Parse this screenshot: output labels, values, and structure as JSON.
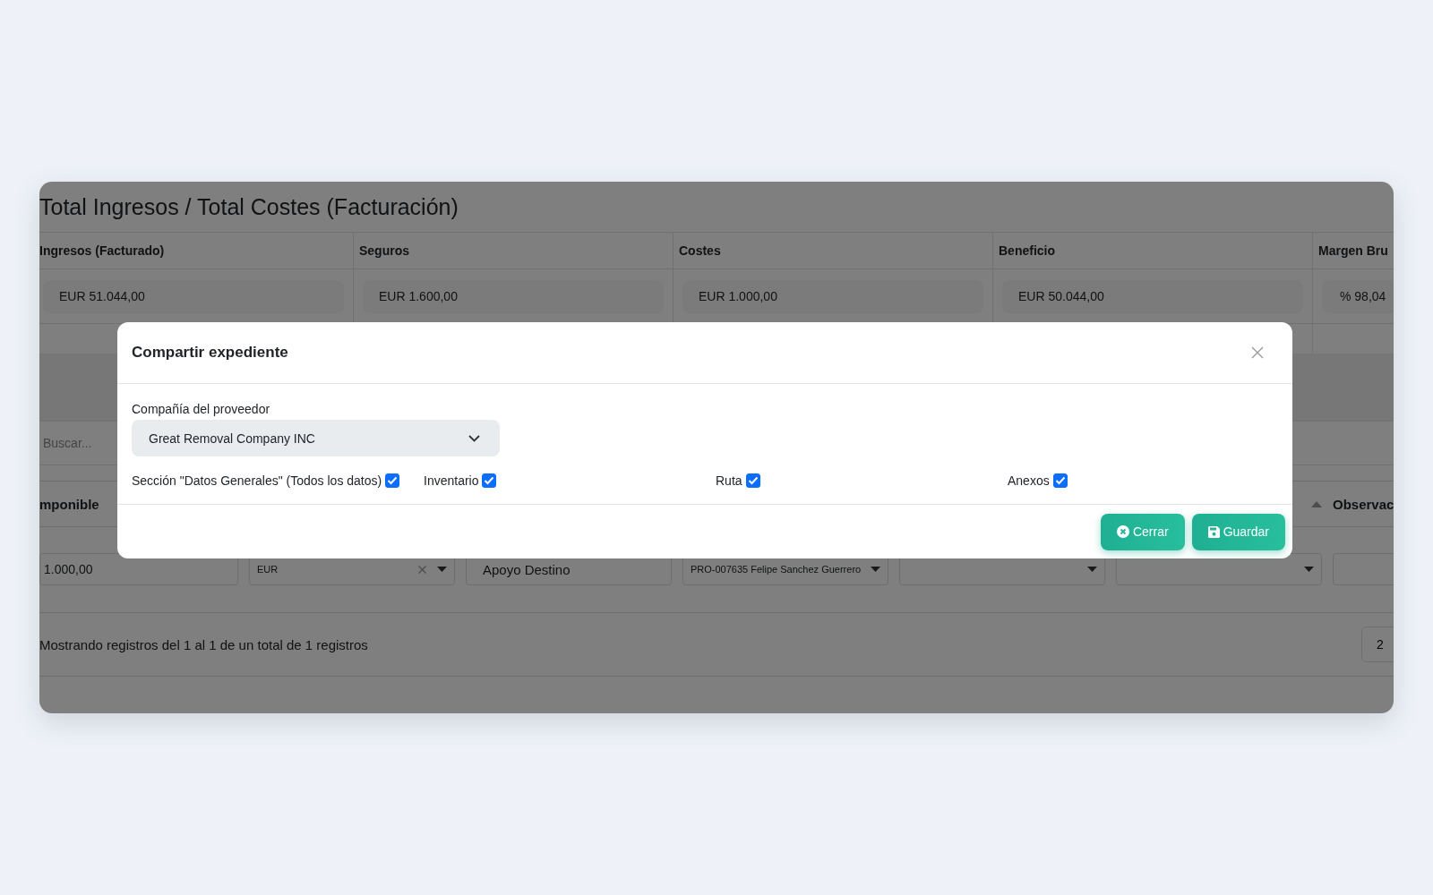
{
  "page": {
    "title": "Total Ingresos / Total Costes (Facturación)",
    "summary": [
      {
        "label": "Ingresos (Facturado)",
        "value": "EUR 51.044,00"
      },
      {
        "label": "Seguros",
        "value": "EUR 1.600,00"
      },
      {
        "label": "Costes",
        "value": "EUR 1.000,00"
      },
      {
        "label": "Beneficio",
        "value": "EUR 50.044,00"
      },
      {
        "label": "Margen Bru",
        "value": "% 98,04"
      }
    ],
    "search": {
      "placeholder": "Buscar..."
    },
    "table": {
      "columns": [
        {
          "label": "mponible"
        },
        {
          "label": "Observac"
        }
      ],
      "rows": [
        {
          "cells": [
            {
              "kind": "input",
              "value": "1.000,00"
            },
            {
              "kind": "select",
              "value": "EUR",
              "clearable": true
            },
            {
              "kind": "input",
              "value": "Apoyo Destino"
            },
            {
              "kind": "select",
              "value": "PRO-007635 Felipe Sanchez Guerrero"
            },
            {
              "kind": "select"
            },
            {
              "kind": "select"
            },
            {
              "kind": "input"
            }
          ]
        }
      ]
    },
    "info": "Mostrando registros del 1 al 1 de un total de 1 registros",
    "pagination": [
      "2"
    ]
  },
  "modal": {
    "title": "Compartir expediente",
    "field": {
      "label": "Compañía del proveedor",
      "value": "Great Removal Company INC"
    },
    "options": [
      {
        "label": "Sección \"Datos Generales\" (Todos los datos)",
        "checked": true
      },
      {
        "label": "Inventario",
        "checked": true
      },
      {
        "label": "Ruta",
        "checked": true
      },
      {
        "label": "Anexos",
        "checked": true
      }
    ],
    "buttons": [
      {
        "kind": "close",
        "label": "Cerrar"
      },
      {
        "kind": "save",
        "label": "Guardar"
      }
    ]
  }
}
